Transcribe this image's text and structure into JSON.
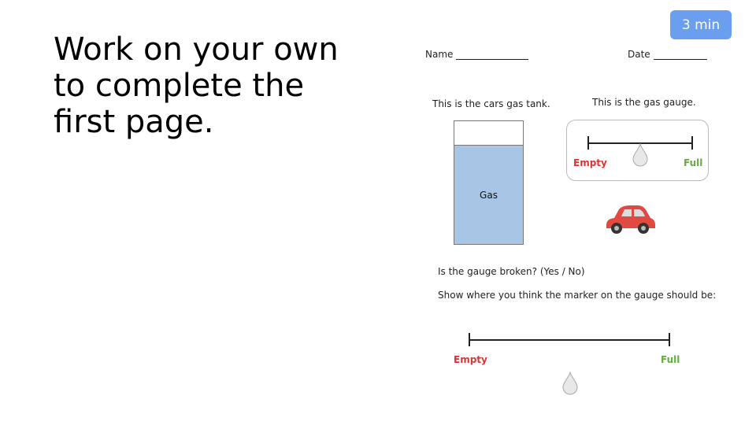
{
  "slide": {
    "title": "Work on your own to complete the first page.",
    "timer": "3 min",
    "timer_color": "#6a9ff0"
  },
  "worksheet": {
    "name_label": "Name",
    "date_label": "Date",
    "tank_caption": "This is the cars gas tank.",
    "gauge_caption": "This is the gas gauge.",
    "tank_label": "Gas",
    "tank_level_fraction": 0.8,
    "gauge": {
      "empty": "Empty",
      "full": "Full",
      "marker_fraction": 0.5
    },
    "question1": "Is the gauge broken?  (Yes / No)",
    "question2": "Show where you think the marker on the gauge should be:",
    "answer_gauge": {
      "empty": "Empty",
      "full": "Full"
    },
    "colors": {
      "empty": "#dd3333",
      "full": "#66aa44",
      "gas": "#a7c5e5",
      "car": "#e04a40"
    }
  }
}
